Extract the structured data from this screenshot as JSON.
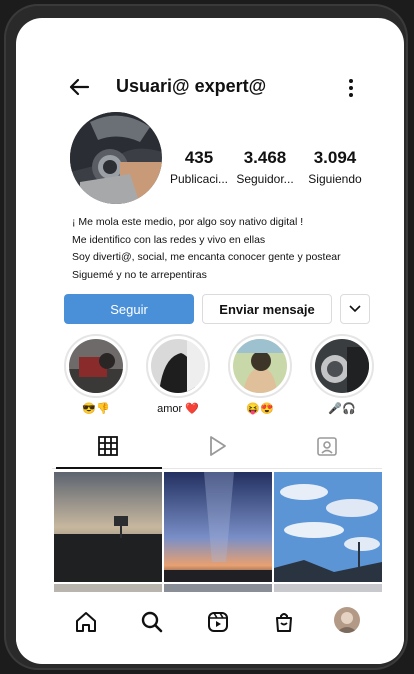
{
  "header": {
    "username": "Usuari@ expert@"
  },
  "stats": [
    {
      "value": "435",
      "label": "Publicaci..."
    },
    {
      "value": "3.468",
      "label": "Seguidor..."
    },
    {
      "value": "3.094",
      "label": "Siguiendo"
    }
  ],
  "bio": [
    "¡ Me mola este medio, por algo soy nativo digital !",
    "Me identifico con las redes y vivo en ellas",
    "Soy diverti@, social, me encanta conocer gente y postear",
    "Siguemé y no te arrepentiras"
  ],
  "buttons": {
    "follow": "Seguir",
    "message": "Enviar mensaje"
  },
  "highlights": [
    {
      "label": "😎👎"
    },
    {
      "label": "amor ❤️"
    },
    {
      "label": "😝😍"
    },
    {
      "label": "🎤🎧"
    }
  ],
  "colors": {
    "follow_button": "#4a90d9",
    "background": "#ffffff"
  },
  "icons": {
    "back": "arrow-left-icon",
    "more": "more-vertical-icon",
    "tabs": [
      "grid-icon",
      "reels-play-icon",
      "tagged-icon"
    ],
    "nav": [
      "home-icon",
      "search-icon",
      "reels-icon",
      "shop-icon",
      "profile-avatar"
    ]
  }
}
